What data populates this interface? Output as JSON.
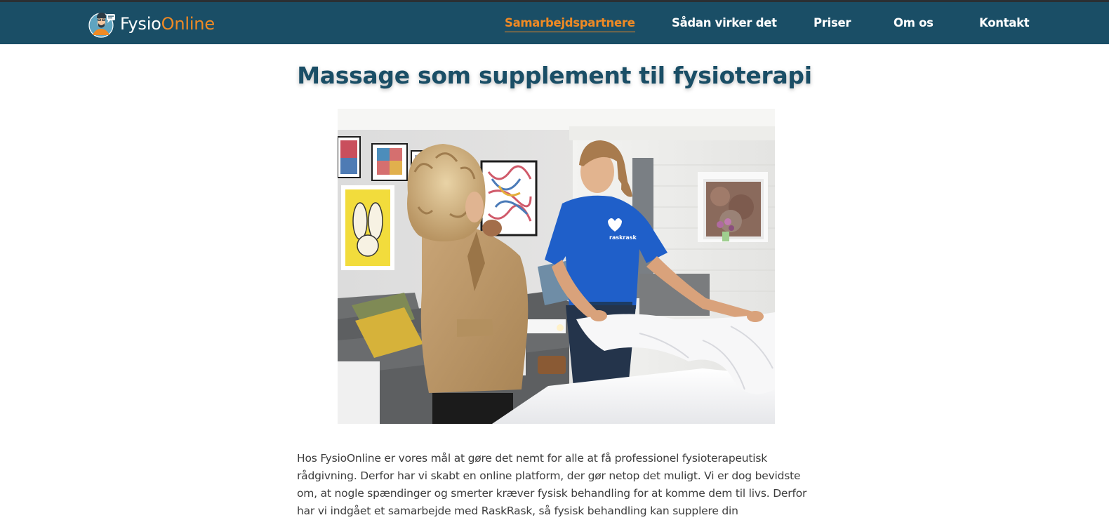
{
  "brand": {
    "name_part1": "Fysio",
    "name_part2": "Online",
    "color_primary": "#1a4e66",
    "color_accent": "#f08a24"
  },
  "nav": {
    "items": [
      {
        "label": "Samarbejdspartnere",
        "active": true
      },
      {
        "label": "Sådan virker det",
        "active": false
      },
      {
        "label": "Priser",
        "active": false
      },
      {
        "label": "Om os",
        "active": false
      },
      {
        "label": "Kontakt",
        "active": false
      }
    ]
  },
  "main": {
    "title": "Massage som supplement til fysioterapi",
    "hero_image": {
      "t_shirt_text": "raskrask"
    },
    "intro_text": "Hos FysioOnline er vores mål at gøre det nemt for alle at få professionel fysioterapeutisk rådgivning. Derfor har vi skabt en online platform, der gør netop det muligt. Vi er dog bevidste om, at nogle spændinger og smerter kræver fysisk behandling for at komme dem til livs. Derfor har vi indgået et samarbejde med RaskRask, så fysisk behandling kan supplere din"
  }
}
